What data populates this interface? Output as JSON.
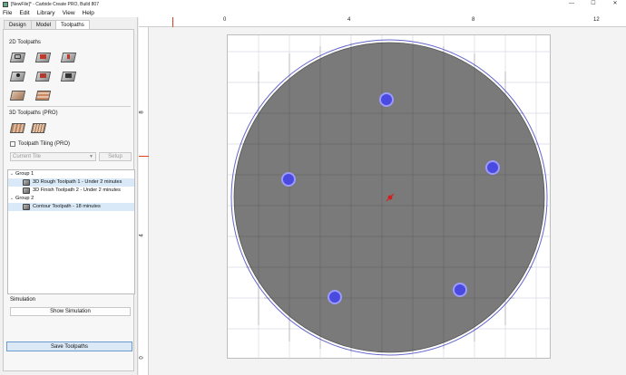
{
  "window": {
    "title": "[NewFile]* - Carbide Create PRO, Build 807",
    "controls": [
      "—",
      "☐",
      "✕"
    ]
  },
  "menu": [
    "File",
    "Edit",
    "Library",
    "View",
    "Help"
  ],
  "tabs": [
    "Design",
    "Model",
    "Toolpaths"
  ],
  "toolpaths_panel": {
    "section_2d": "2D Toolpaths",
    "section_3d": "3D Toolpaths (PRO)",
    "tiling_label": "Toolpath Tiling (PRO)",
    "tile_combo": "Current Tile",
    "setup_button": "Setup",
    "groups": [
      {
        "label": "Group 1",
        "items": [
          "3D Rough Toolpath 1 - Under 2 minutes",
          "3D Finish Toolpath 2 - Under 2 minutes"
        ]
      },
      {
        "label": "Group 2",
        "items": [
          "Contour Toolpath - 18 minutes"
        ]
      }
    ],
    "simulation_label": "Simulation",
    "show_simulation_button": "Show Simulation",
    "save_toolpaths_button": "Save Toolpaths"
  },
  "canvas": {
    "ruler_x_labels": [
      "0",
      "4",
      "8",
      "12"
    ],
    "ruler_y_labels": [
      "8",
      "4",
      "0"
    ],
    "colors": {
      "stock": "#7a7a7a",
      "outline": "#6666cc",
      "holes": "#4a4ae0",
      "origin": "#d02020",
      "grid": "#d8d8e4"
    }
  }
}
